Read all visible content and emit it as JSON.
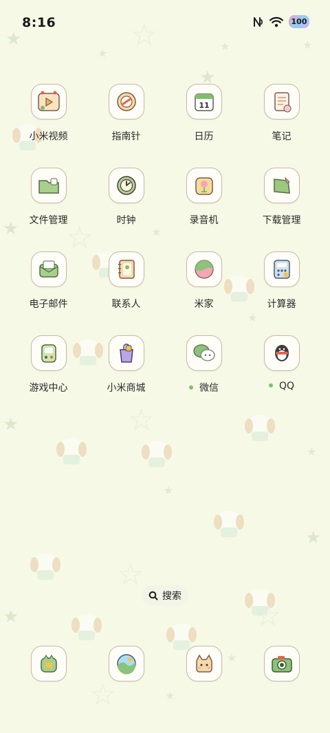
{
  "status_bar": {
    "time": "8:16",
    "battery": "100",
    "icons": [
      "nfc-icon",
      "wifi-icon",
      "battery-icon"
    ]
  },
  "apps": [
    {
      "label": "小米视频",
      "icon": "video-icon"
    },
    {
      "label": "指南针",
      "icon": "compass-icon"
    },
    {
      "label": "日历",
      "icon": "calendar-icon",
      "date": "11"
    },
    {
      "label": "笔记",
      "icon": "notes-icon"
    },
    {
      "label": "文件管理",
      "icon": "folder-icon"
    },
    {
      "label": "时钟",
      "icon": "clock-icon"
    },
    {
      "label": "录音机",
      "icon": "recorder-icon"
    },
    {
      "label": "下载管理",
      "icon": "download-icon"
    },
    {
      "label": "电子邮件",
      "icon": "mail-icon"
    },
    {
      "label": "联系人",
      "icon": "contacts-icon"
    },
    {
      "label": "米家",
      "icon": "mijia-icon"
    },
    {
      "label": "计算器",
      "icon": "calculator-icon"
    },
    {
      "label": "游戏中心",
      "icon": "game-center-icon"
    },
    {
      "label": "小米商城",
      "icon": "shopping-bag-icon"
    },
    {
      "label": "微信",
      "icon": "wechat-icon",
      "new_indicator": true
    },
    {
      "label": "QQ",
      "icon": "qq-penguin-icon",
      "new_indicator": true
    }
  ],
  "search": {
    "label": "搜索",
    "icon": "search-icon"
  },
  "dock": [
    {
      "icon": "phone-icon"
    },
    {
      "icon": "gallery-icon"
    },
    {
      "icon": "messages-icon"
    },
    {
      "icon": "camera-icon"
    }
  ],
  "colors": {
    "background": "#f6f9e6",
    "icon_border": "#c7b9a8",
    "indicator_dot": "#7fc06c"
  }
}
